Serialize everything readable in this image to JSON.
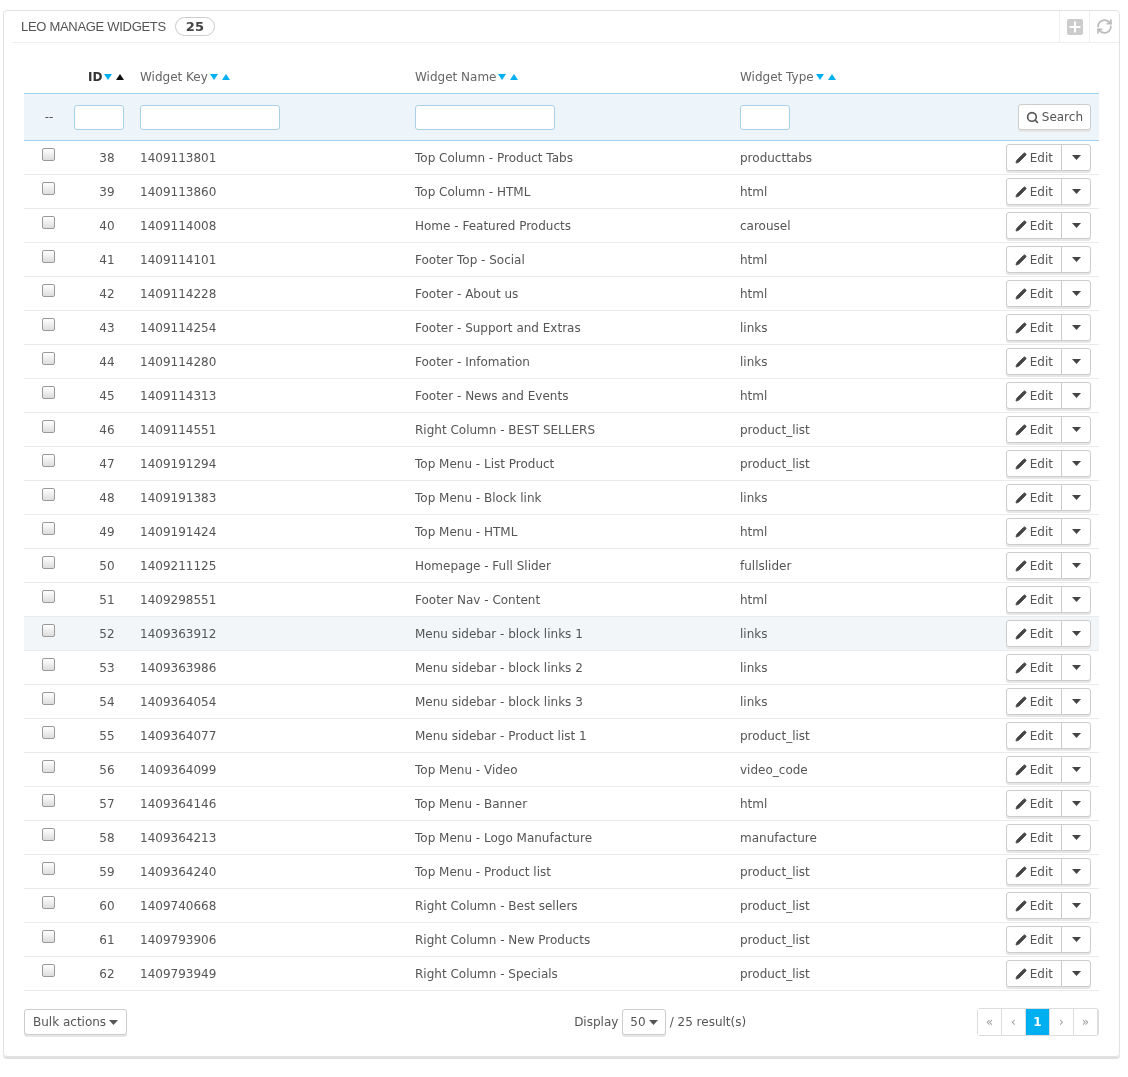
{
  "panel": {
    "title": "LEO MANAGE WIDGETS",
    "count": "25"
  },
  "table": {
    "columns": [
      {
        "label": "ID",
        "sorted_asc": true
      },
      {
        "label": "Widget Key",
        "sorted_asc": false
      },
      {
        "label": "Widget Name",
        "sorted_asc": false
      },
      {
        "label": "Widget Type",
        "sorted_asc": false
      }
    ],
    "filter_placeholder": "--",
    "search_button": "Search",
    "rows": [
      {
        "id": "38",
        "key": "1409113801",
        "name": "Top Column - Product Tabs",
        "type": "producttabs",
        "edit": "Edit",
        "checked": false,
        "highlighted": false
      },
      {
        "id": "39",
        "key": "1409113860",
        "name": "Top Column - HTML",
        "type": "html",
        "edit": "Edit",
        "checked": false,
        "highlighted": false
      },
      {
        "id": "40",
        "key": "1409114008",
        "name": "Home - Featured Products",
        "type": "carousel",
        "edit": "Edit",
        "checked": false,
        "highlighted": false
      },
      {
        "id": "41",
        "key": "1409114101",
        "name": "Footer Top - Social",
        "type": "html",
        "edit": "Edit",
        "checked": false,
        "highlighted": false
      },
      {
        "id": "42",
        "key": "1409114228",
        "name": "Footer - About us",
        "type": "html",
        "edit": "Edit",
        "checked": false,
        "highlighted": false
      },
      {
        "id": "43",
        "key": "1409114254",
        "name": "Footer - Support and Extras",
        "type": "links",
        "edit": "Edit",
        "checked": false,
        "highlighted": false
      },
      {
        "id": "44",
        "key": "1409114280",
        "name": "Footer - Infomation",
        "type": "links",
        "edit": "Edit",
        "checked": false,
        "highlighted": false
      },
      {
        "id": "45",
        "key": "1409114313",
        "name": "Footer - News and Events",
        "type": "html",
        "edit": "Edit",
        "checked": false,
        "highlighted": false
      },
      {
        "id": "46",
        "key": "1409114551",
        "name": "Right Column - BEST SELLERS",
        "type": "product_list",
        "edit": "Edit",
        "checked": false,
        "highlighted": false
      },
      {
        "id": "47",
        "key": "1409191294",
        "name": "Top Menu - List Product",
        "type": "product_list",
        "edit": "Edit",
        "checked": false,
        "highlighted": false
      },
      {
        "id": "48",
        "key": "1409191383",
        "name": "Top Menu - Block link",
        "type": "links",
        "edit": "Edit",
        "checked": false,
        "highlighted": false
      },
      {
        "id": "49",
        "key": "1409191424",
        "name": "Top Menu - HTML",
        "type": "html",
        "edit": "Edit",
        "checked": false,
        "highlighted": false
      },
      {
        "id": "50",
        "key": "1409211125",
        "name": "Homepage - Full Slider",
        "type": "fullslider",
        "edit": "Edit",
        "checked": false,
        "highlighted": false
      },
      {
        "id": "51",
        "key": "1409298551",
        "name": "Footer Nav - Content",
        "type": "html",
        "edit": "Edit",
        "checked": false,
        "highlighted": false
      },
      {
        "id": "52",
        "key": "1409363912",
        "name": "Menu sidebar - block links 1",
        "type": "links",
        "edit": "Edit",
        "checked": false,
        "highlighted": true
      },
      {
        "id": "53",
        "key": "1409363986",
        "name": "Menu sidebar - block links 2",
        "type": "links",
        "edit": "Edit",
        "checked": false,
        "highlighted": false
      },
      {
        "id": "54",
        "key": "1409364054",
        "name": "Menu sidebar - block links 3",
        "type": "links",
        "edit": "Edit",
        "checked": false,
        "highlighted": false
      },
      {
        "id": "55",
        "key": "1409364077",
        "name": "Menu sidebar - Product list 1",
        "type": "product_list",
        "edit": "Edit",
        "checked": false,
        "highlighted": false
      },
      {
        "id": "56",
        "key": "1409364099",
        "name": "Top Menu - Video",
        "type": "video_code",
        "edit": "Edit",
        "checked": false,
        "highlighted": false
      },
      {
        "id": "57",
        "key": "1409364146",
        "name": "Top Menu - Banner",
        "type": "html",
        "edit": "Edit",
        "checked": false,
        "highlighted": false
      },
      {
        "id": "58",
        "key": "1409364213",
        "name": "Top Menu - Logo Manufacture",
        "type": "manufacture",
        "edit": "Edit",
        "checked": false,
        "highlighted": false
      },
      {
        "id": "59",
        "key": "1409364240",
        "name": "Top Menu - Product list",
        "type": "product_list",
        "edit": "Edit",
        "checked": false,
        "highlighted": false
      },
      {
        "id": "60",
        "key": "1409740668",
        "name": "Right Column - Best sellers",
        "type": "product_list",
        "edit": "Edit",
        "checked": false,
        "highlighted": false
      },
      {
        "id": "61",
        "key": "1409793906",
        "name": "Right Column - New Products",
        "type": "product_list",
        "edit": "Edit",
        "checked": false,
        "highlighted": false
      },
      {
        "id": "62",
        "key": "1409793949",
        "name": "Right Column - Specials",
        "type": "product_list",
        "edit": "Edit",
        "checked": false,
        "highlighted": false
      }
    ]
  },
  "footer": {
    "bulk_actions": "Bulk actions",
    "display_label": "Display",
    "per_page": "50",
    "results": "/ 25 result(s)",
    "pagination": [
      {
        "label": "«",
        "selected": false
      },
      {
        "label": "‹",
        "selected": false
      },
      {
        "label": "1",
        "selected": true
      },
      {
        "label": "›",
        "selected": false
      },
      {
        "label": "»",
        "selected": false
      }
    ]
  }
}
